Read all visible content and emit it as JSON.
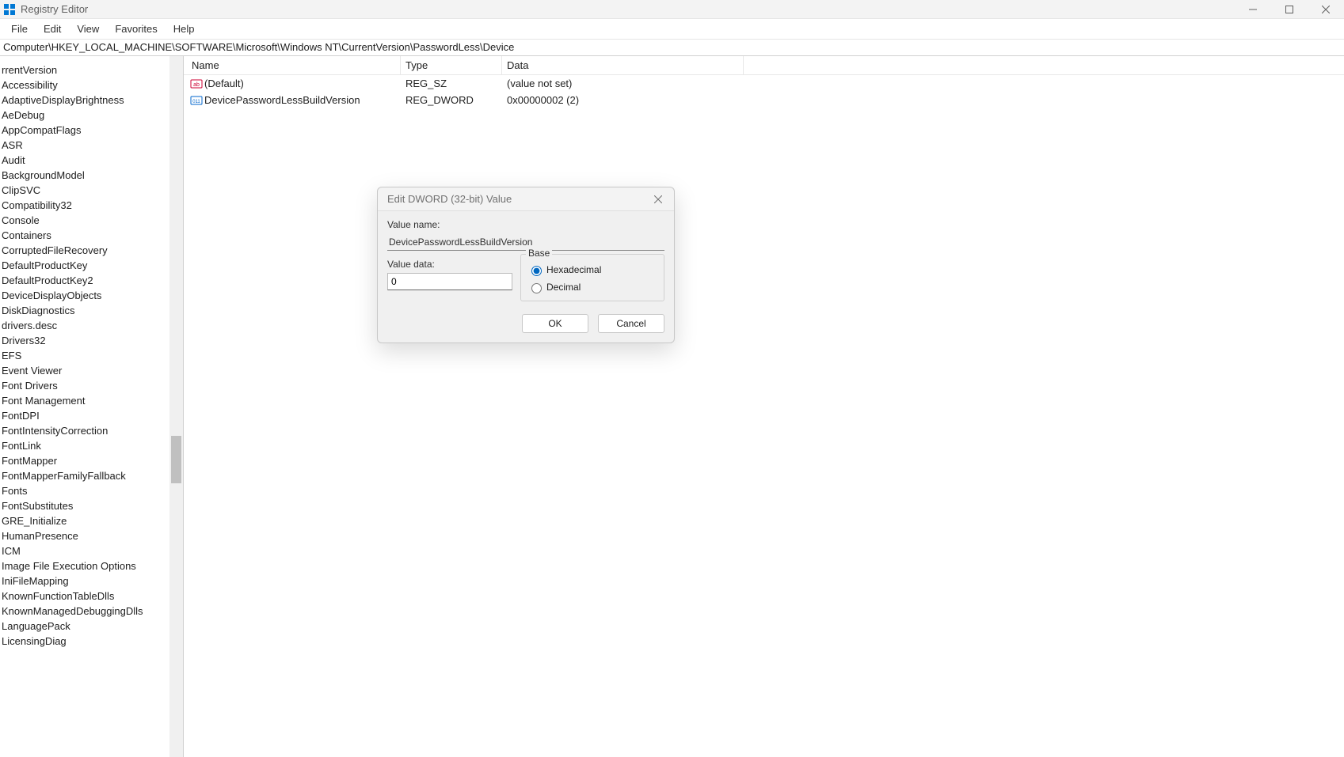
{
  "window": {
    "title": "Registry Editor"
  },
  "menu": {
    "file": "File",
    "edit": "Edit",
    "view": "View",
    "favorites": "Favorites",
    "help": "Help"
  },
  "address": "Computer\\HKEY_LOCAL_MACHINE\\SOFTWARE\\Microsoft\\Windows NT\\CurrentVersion\\PasswordLess\\Device",
  "tree": [
    "rrentVersion",
    "Accessibility",
    "AdaptiveDisplayBrightness",
    "AeDebug",
    "AppCompatFlags",
    "ASR",
    "Audit",
    "BackgroundModel",
    "ClipSVC",
    "Compatibility32",
    "Console",
    "Containers",
    "CorruptedFileRecovery",
    "DefaultProductKey",
    "DefaultProductKey2",
    "DeviceDisplayObjects",
    "DiskDiagnostics",
    "drivers.desc",
    "Drivers32",
    "EFS",
    "Event Viewer",
    "Font Drivers",
    "Font Management",
    "FontDPI",
    "FontIntensityCorrection",
    "FontLink",
    "FontMapper",
    "FontMapperFamilyFallback",
    "Fonts",
    "FontSubstitutes",
    "GRE_Initialize",
    "HumanPresence",
    "ICM",
    "Image File Execution Options",
    "IniFileMapping",
    "KnownFunctionTableDlls",
    "KnownManagedDebuggingDlls",
    "LanguagePack",
    "LicensingDiag"
  ],
  "columns": {
    "name": "Name",
    "type": "Type",
    "data": "Data"
  },
  "values": [
    {
      "icon": "sz",
      "name": "(Default)",
      "type": "REG_SZ",
      "data": "(value not set)"
    },
    {
      "icon": "dword",
      "name": "DevicePasswordLessBuildVersion",
      "type": "REG_DWORD",
      "data": "0x00000002 (2)"
    }
  ],
  "dialog": {
    "title": "Edit DWORD (32-bit) Value",
    "value_name_label": "Value name:",
    "value_name": "DevicePasswordLessBuildVersion",
    "value_data_label": "Value data:",
    "value_data": "0",
    "base_label": "Base",
    "hex_label": "Hexadecimal",
    "dec_label": "Decimal",
    "ok": "OK",
    "cancel": "Cancel"
  }
}
